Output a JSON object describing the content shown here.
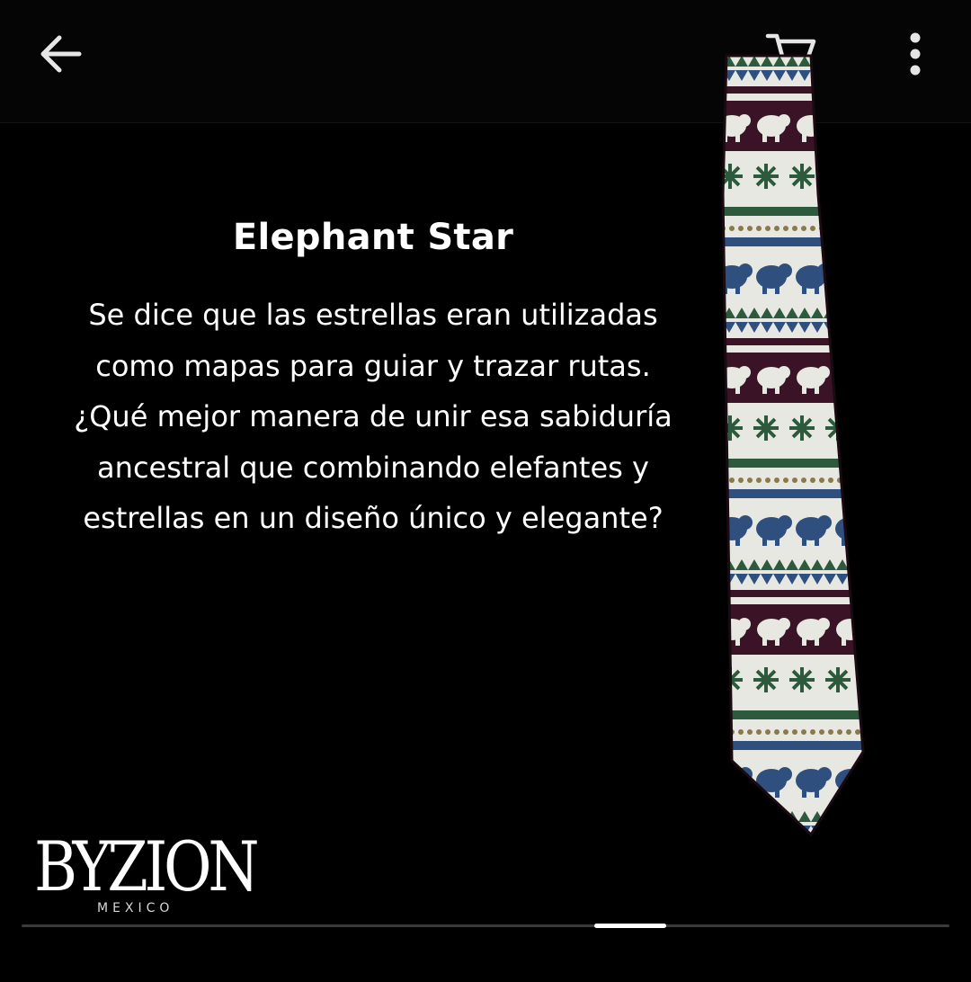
{
  "topbar": {
    "back_icon": "arrow-left-icon",
    "cart_icon": "shopping-cart-icon",
    "more_icon": "more-vertical-icon"
  },
  "product": {
    "title": "Elephant Star",
    "description": "Se dice que las estrellas eran utilizadas como mapas para guiar y trazar rutas. ¿Qué mejor manera de unir esa sabiduría ancestral que combinando elefantes y estrellas en un diseño único y elegante?",
    "image_icon": "tie-image"
  },
  "brand": {
    "logo_text": "BYZION",
    "subtitle": "MEXICO"
  },
  "carousel": {
    "position_fraction": 0.617,
    "visible_fraction": 0.078
  },
  "colors": {
    "background": "#000000",
    "text": "#ffffff",
    "tie_base": "#e8e8e2",
    "tie_blue": "#2f4f7f",
    "tie_green": "#2d5a3d",
    "tie_maroon": "#3a1426"
  }
}
